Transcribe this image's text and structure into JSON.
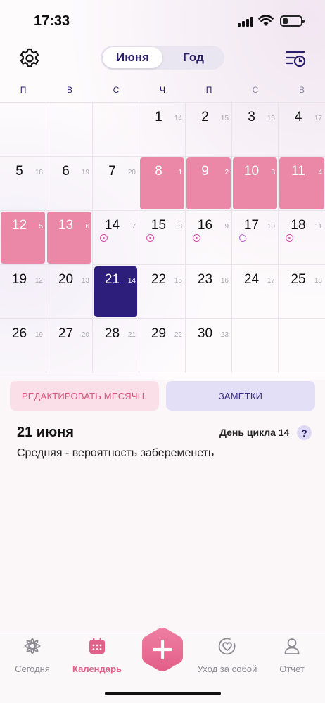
{
  "status_bar": {
    "time": "17:33"
  },
  "header": {
    "segments": [
      {
        "label": "Июня",
        "active": true
      },
      {
        "label": "Год",
        "active": false
      }
    ],
    "settings_icon": "gear-icon",
    "history_icon": "list-clock-icon"
  },
  "weekdays": [
    "П",
    "В",
    "С",
    "Ч",
    "П",
    "С",
    "В"
  ],
  "calendar": {
    "month": "Июня",
    "days": [
      {
        "day": "1",
        "cycle": "14",
        "type": "normal"
      },
      {
        "day": "2",
        "cycle": "15",
        "type": "normal"
      },
      {
        "day": "3",
        "cycle": "16",
        "type": "normal"
      },
      {
        "day": "4",
        "cycle": "17",
        "type": "normal"
      },
      {
        "day": "5",
        "cycle": "18",
        "type": "normal"
      },
      {
        "day": "6",
        "cycle": "19",
        "type": "normal"
      },
      {
        "day": "7",
        "cycle": "20",
        "type": "normal"
      },
      {
        "day": "8",
        "cycle": "1",
        "type": "period"
      },
      {
        "day": "9",
        "cycle": "2",
        "type": "period"
      },
      {
        "day": "10",
        "cycle": "3",
        "type": "period"
      },
      {
        "day": "11",
        "cycle": "4",
        "type": "period"
      },
      {
        "day": "12",
        "cycle": "5",
        "type": "period"
      },
      {
        "day": "13",
        "cycle": "6",
        "type": "period"
      },
      {
        "day": "14",
        "cycle": "7",
        "type": "fertile"
      },
      {
        "day": "15",
        "cycle": "8",
        "type": "fertile"
      },
      {
        "day": "16",
        "cycle": "9",
        "type": "fertile"
      },
      {
        "day": "17",
        "cycle": "10",
        "type": "ovulation"
      },
      {
        "day": "18",
        "cycle": "11",
        "type": "fertile"
      },
      {
        "day": "19",
        "cycle": "12",
        "type": "normal"
      },
      {
        "day": "20",
        "cycle": "13",
        "type": "normal"
      },
      {
        "day": "21",
        "cycle": "14",
        "type": "today"
      },
      {
        "day": "22",
        "cycle": "15",
        "type": "normal"
      },
      {
        "day": "23",
        "cycle": "16",
        "type": "normal"
      },
      {
        "day": "24",
        "cycle": "17",
        "type": "normal"
      },
      {
        "day": "25",
        "cycle": "18",
        "type": "normal"
      },
      {
        "day": "26",
        "cycle": "19",
        "type": "normal"
      },
      {
        "day": "27",
        "cycle": "20",
        "type": "normal"
      },
      {
        "day": "28",
        "cycle": "21",
        "type": "normal"
      },
      {
        "day": "29",
        "cycle": "22",
        "type": "normal"
      },
      {
        "day": "30",
        "cycle": "23",
        "type": "normal"
      }
    ],
    "colors": {
      "period": "#eb88a8",
      "today": "#2c1e7a",
      "fertile": "#d24fa8"
    }
  },
  "actions": {
    "edit_period": "РЕДАКТИРОВАТЬ МЕСЯЧН.",
    "notes": "ЗАМЕТКИ"
  },
  "info": {
    "date": "21 июня",
    "cycle_day": "День цикла 14",
    "help": "?",
    "probability": "Средняя - вероятность забеременеть"
  },
  "tabbar": {
    "tabs": [
      {
        "label": "Сегодня",
        "icon": "gear-flower-icon",
        "active": false
      },
      {
        "label": "Календарь",
        "icon": "calendar-icon",
        "active": true
      },
      {
        "label": "Уход за собой",
        "icon": "heart-circle-icon",
        "active": false
      },
      {
        "label": "Отчет",
        "icon": "person-icon",
        "active": false
      }
    ],
    "add_icon": "plus-icon"
  }
}
